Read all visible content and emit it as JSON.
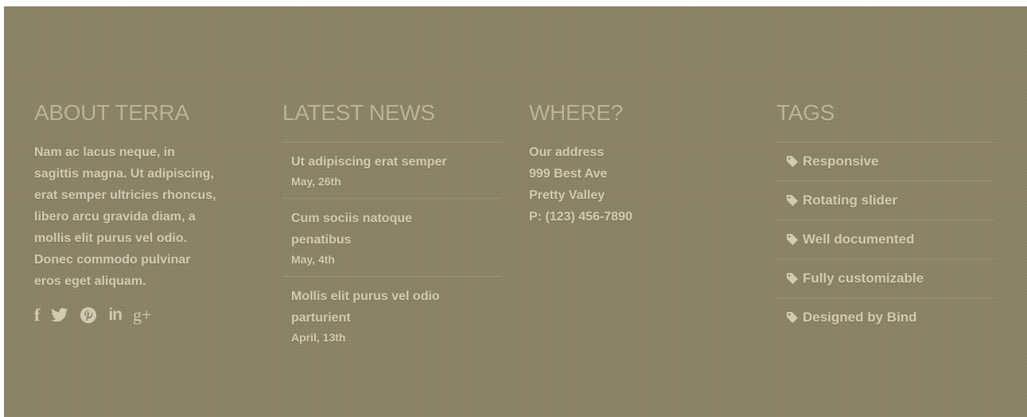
{
  "about": {
    "heading": "ABOUT TERRA",
    "lines": [
      "Nam ac lacus neque, in",
      "sagittis magna. Ut adipiscing,",
      "erat semper ultricies rhoncus,",
      "libero arcu gravida diam, a",
      "mollis elit purus vel odio.",
      "Donec commodo pulvinar",
      "eros eget aliquam."
    ],
    "social": {
      "facebook": "f",
      "linkedin": "in",
      "googleplus": "g+"
    }
  },
  "news": {
    "heading": "LATEST NEWS",
    "items": [
      {
        "title_lines": [
          "Ut adipiscing erat semper"
        ],
        "date": "May, 26th"
      },
      {
        "title_lines": [
          "Cum sociis natoque",
          "penatibus"
        ],
        "date": "May, 4th"
      },
      {
        "title_lines": [
          "Mollis elit purus vel odio",
          "parturient"
        ],
        "date": "April, 13th"
      }
    ]
  },
  "where": {
    "heading": "WHERE?",
    "lines": [
      "Our address",
      "999 Best Ave",
      "Pretty Valley",
      "P: (123) 456-7890"
    ]
  },
  "tags": {
    "heading": "TAGS",
    "items": [
      "Responsive",
      "Rotating slider",
      "Well documented",
      "Fully customizable",
      "Designed by Bind"
    ]
  },
  "colors": {
    "background": "#8b8264",
    "heading": "#bcb498",
    "text": "#d2cbb2"
  }
}
